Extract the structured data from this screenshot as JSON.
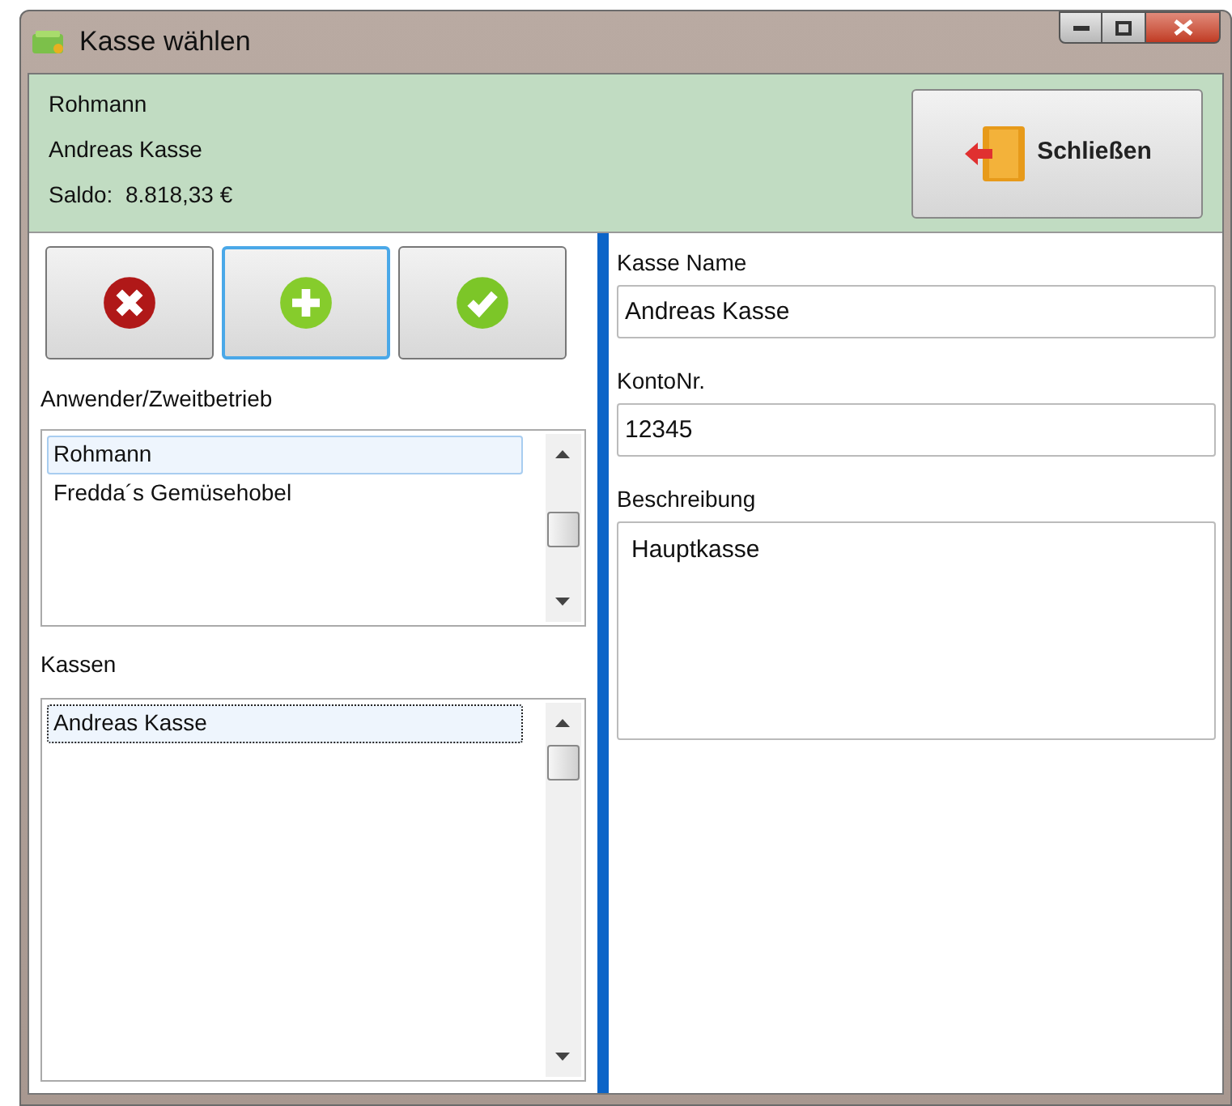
{
  "window": {
    "title": "Kasse wählen"
  },
  "header": {
    "lines": [
      "Rohmann",
      "Andreas Kasse",
      "Saldo:  8.818,33 €"
    ],
    "close_button": "Schließen"
  },
  "toolbar": [
    {
      "kind": "delete",
      "selected": false
    },
    {
      "kind": "add",
      "selected": true
    },
    {
      "kind": "confirm",
      "selected": false
    }
  ],
  "users": {
    "label": "Anwender/Zweitbetrieb",
    "items": [
      {
        "text": "Rohmann",
        "selected": true
      },
      {
        "text": "Fredda´s Gemüsehobel",
        "selected": false
      }
    ]
  },
  "registers": {
    "label": "Kassen",
    "items": [
      {
        "text": "Andreas Kasse",
        "selected": true
      }
    ]
  },
  "form": [
    {
      "kind": "input",
      "label": "Kasse Name",
      "value": "Andreas Kasse"
    },
    {
      "kind": "input",
      "label": "KontoNr.",
      "value": "12345"
    },
    {
      "kind": "textarea",
      "label": "Beschreibung",
      "value": "Hauptkasse"
    }
  ]
}
